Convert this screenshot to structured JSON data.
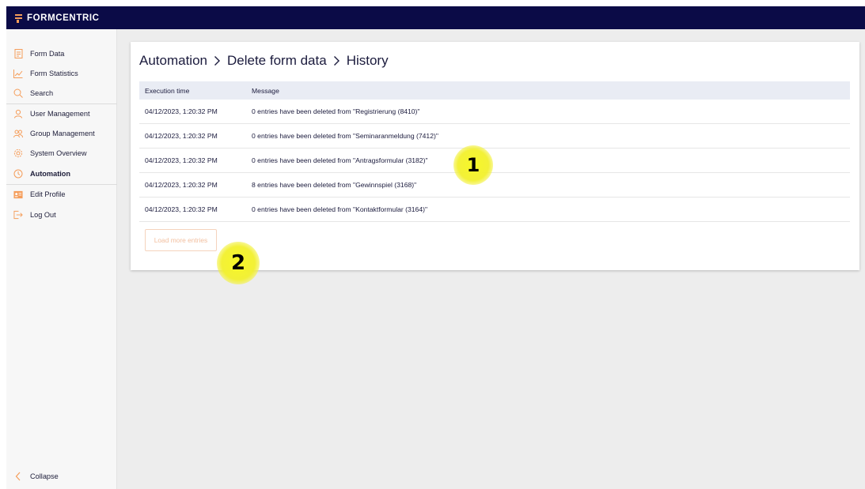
{
  "app": {
    "brand": "FORMCENTRIC"
  },
  "sidebar": {
    "items": [
      {
        "label": "Form Data",
        "icon": "form-data-icon"
      },
      {
        "label": "Form Statistics",
        "icon": "chart-line-icon"
      },
      {
        "label": "Search",
        "icon": "search-icon"
      },
      {
        "label": "User Management",
        "icon": "user-icon"
      },
      {
        "label": "Group Management",
        "icon": "group-icon"
      },
      {
        "label": "System Overview",
        "icon": "gear-icon"
      },
      {
        "label": "Automation",
        "icon": "clock-icon",
        "active": true
      },
      {
        "label": "Edit Profile",
        "icon": "id-card-icon"
      },
      {
        "label": "Log Out",
        "icon": "logout-icon"
      }
    ],
    "collapse_label": "Collapse"
  },
  "breadcrumb": {
    "items": [
      "Automation",
      "Delete form data",
      "History"
    ]
  },
  "table": {
    "headers": {
      "time": "Execution time",
      "message": "Message"
    },
    "rows": [
      {
        "time": "04/12/2023, 1:20:32 PM",
        "message": "0 entries have been deleted from \"Registrierung (8410)\""
      },
      {
        "time": "04/12/2023, 1:20:32 PM",
        "message": "0 entries have been deleted from \"Seminaranmeldung (7412)\""
      },
      {
        "time": "04/12/2023, 1:20:32 PM",
        "message": "0 entries have been deleted from \"Antragsformular (3182)\""
      },
      {
        "time": "04/12/2023, 1:20:32 PM",
        "message": "8 entries have been deleted from \"Gewinnspiel (3168)\""
      },
      {
        "time": "04/12/2023, 1:20:32 PM",
        "message": "0 entries have been deleted from \"Kontaktformular (3164)\""
      }
    ]
  },
  "load_more_label": "Load more entries",
  "annotations": {
    "marker1": "1",
    "marker2": "2"
  },
  "colors": {
    "topbar": "#0b0b47",
    "accent": "#f59d5a",
    "text": "#1b1b3d"
  }
}
